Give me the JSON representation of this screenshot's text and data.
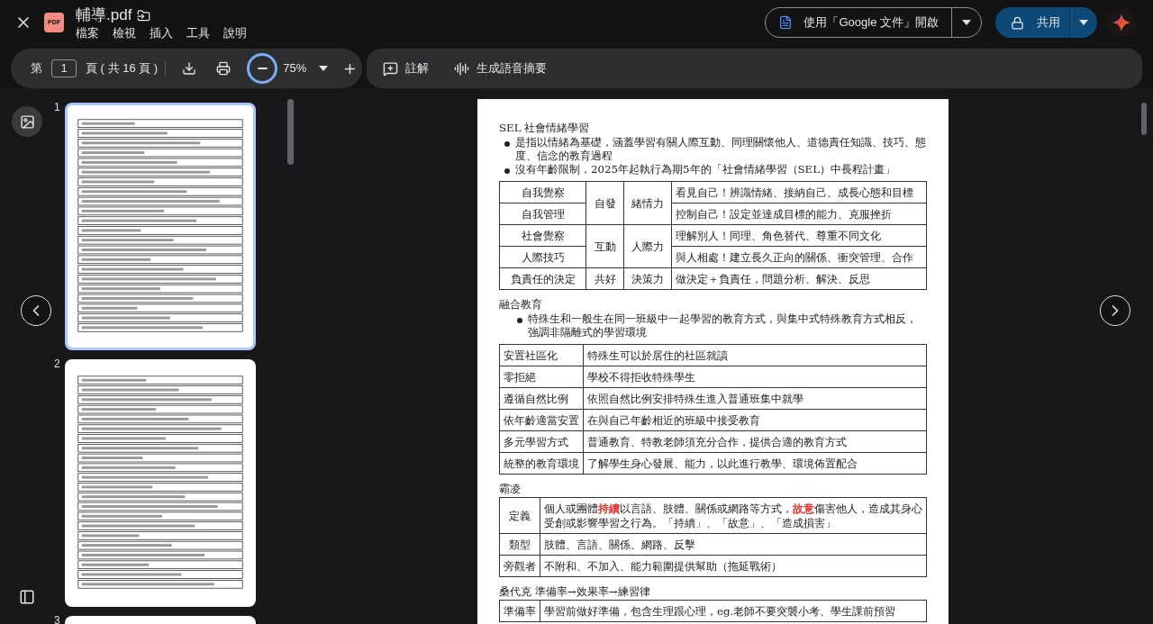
{
  "header": {
    "file_badge": "PDF",
    "title": "輔導.pdf",
    "menu": [
      "檔案",
      "檢視",
      "插入",
      "工具",
      "說明"
    ],
    "open_with": "使用「Google 文件」開啟",
    "share": "共用"
  },
  "toolbar": {
    "page_prefix": "第",
    "page": "1",
    "page_suffix": "頁 ( 共 16 頁 )",
    "zoom": "75%",
    "comment": "註解",
    "audio_summary": "生成語音摘要"
  },
  "thumbnails": [
    {
      "number": "1",
      "selected": true
    },
    {
      "number": "2",
      "selected": false
    },
    {
      "number": "3",
      "selected": false
    }
  ],
  "document": [
    {
      "heading": "SEL 社會情緒學習",
      "bullets": [
        "是指以情緒為基礎，涵蓋學習有關人際互動、同理關懷他人、道德責任知識、技巧、態度、信念的教育過程",
        "沒有年齡限制，2025年起執行為期5年的「社會情緒學習（SEL）中長程計畫」"
      ],
      "table": {
        "kind": "grouped",
        "groups": [
          {
            "domain": "自發",
            "ability": "緒情力",
            "rows": [
              [
                "自我覺察",
                "看見自己！辨識情緒、接納自己、成長心態和目標"
              ],
              [
                "自我管理",
                "控制自己！設定並達成目標的能力、克服挫折"
              ]
            ]
          },
          {
            "domain": "互動",
            "ability": "人際力",
            "rows": [
              [
                "社會覺察",
                "理解別人！同理、角色替代、尊重不同文化"
              ],
              [
                "人際技巧",
                "與人相處！建立長久正向的關係、衝突管理、合作"
              ]
            ]
          },
          {
            "domain": "共好",
            "ability": "決策力",
            "rows": [
              [
                "負責任的決定",
                "做決定＋負責任，問題分析、解決、反思"
              ]
            ]
          }
        ]
      }
    },
    {
      "heading": "融合教育",
      "bullets": [
        "特殊生和一般生在同一班級中一起學習的教育方式，與集中式特殊教育方式相反，強調非隔離式的學習環境"
      ],
      "table": {
        "kind": "list",
        "rows": [
          [
            "安置社區化",
            "特殊生可以於居住的社區就讀"
          ],
          [
            "零拒絕",
            "學校不得拒收特殊學生"
          ],
          [
            "遵循自然比例",
            "依照自然比例安排特殊生進入普通班集中就學"
          ],
          [
            "依年齡適當安置",
            "在與自己年齡相近的班級中接受教育"
          ],
          [
            "多元學習方式",
            "普通教育、特教老師須充分合作，提供合適的教育方式"
          ],
          [
            "統整的教育環境",
            "了解學生身心發展、能力，以此進行教學、環境佈置配合"
          ]
        ]
      }
    },
    {
      "heading": "霸凌",
      "table": {
        "kind": "definitions",
        "rows": [
          [
            "定義",
            [
              {
                "text": "個人或團體"
              },
              {
                "text": "持續",
                "color": "#e53935"
              },
              {
                "text": "以言語、肢體、關係或網路等方式，"
              },
              {
                "text": "故意",
                "color": "#e53935"
              },
              {
                "text": "傷害他人，造成其身心受創或影響學習之行為。「持續」、「故意」、「造成損害」"
              }
            ]
          ],
          [
            "類型",
            "肢體、言語、關係、網路、反擊"
          ],
          [
            "旁觀者",
            "不附和、不加入、能力範圍提供幫助（拖延戰術）"
          ]
        ]
      }
    },
    {
      "heading": "桑代克 準備率→效果率→練習律",
      "table": {
        "kind": "definitions",
        "rows": [
          [
            "準備率",
            "學習前做好準備，包含生理跟心理，eg.老師不要突襲小考、學生課前預習"
          ]
        ]
      }
    }
  ]
}
